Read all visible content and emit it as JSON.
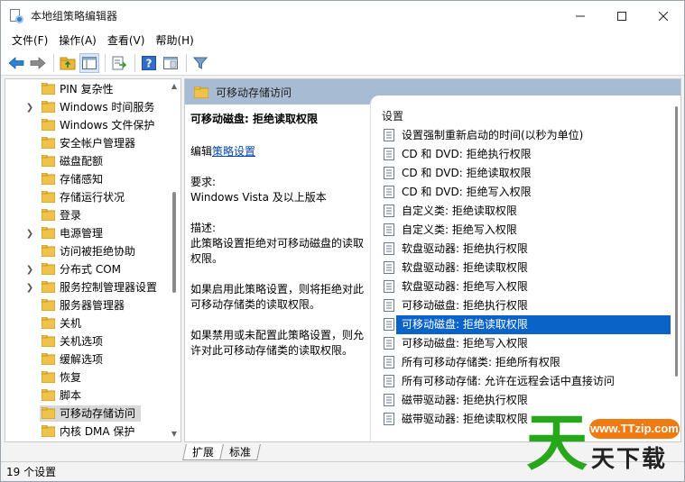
{
  "window": {
    "title": "本地组策略编辑器",
    "controls": [
      "minimize",
      "maximize",
      "close"
    ]
  },
  "menu": [
    {
      "label": "文件(F)"
    },
    {
      "label": "操作(A)"
    },
    {
      "label": "查看(V)"
    },
    {
      "label": "帮助(H)"
    }
  ],
  "toolbar": {
    "icons": [
      "back-arrow-icon",
      "forward-arrow-icon",
      "up-folder-icon",
      "show-hide-tree-icon",
      "export-list-icon",
      "help-icon",
      "properties-icon",
      "filter-icon"
    ]
  },
  "tree": {
    "items": [
      {
        "label": "PIN 复杂性",
        "expandable": false
      },
      {
        "label": "Windows 时间服务",
        "expandable": true
      },
      {
        "label": "Windows 文件保护",
        "expandable": false
      },
      {
        "label": "安全帐户管理器",
        "expandable": false
      },
      {
        "label": "磁盘配额",
        "expandable": false
      },
      {
        "label": "存储感知",
        "expandable": false
      },
      {
        "label": "存储运行状况",
        "expandable": false
      },
      {
        "label": "登录",
        "expandable": false
      },
      {
        "label": "电源管理",
        "expandable": true
      },
      {
        "label": "访问被拒绝协助",
        "expandable": false
      },
      {
        "label": "分布式 COM",
        "expandable": true
      },
      {
        "label": "服务控制管理器设置",
        "expandable": true
      },
      {
        "label": "服务器管理器",
        "expandable": false
      },
      {
        "label": "关机",
        "expandable": false
      },
      {
        "label": "关机选项",
        "expandable": false
      },
      {
        "label": "缓解选项",
        "expandable": false
      },
      {
        "label": "恢复",
        "expandable": false
      },
      {
        "label": "脚本",
        "expandable": false
      },
      {
        "label": "可移动存储访问",
        "expandable": false,
        "selected": true
      },
      {
        "label": "内核 DMA 保护",
        "expandable": false
      }
    ]
  },
  "right": {
    "header": "可移动存储访问",
    "desc": {
      "title": "可移动磁盘: 拒绝读取权限",
      "edit_prefix": "编辑",
      "edit_link": "策略设置",
      "req_label": "要求:",
      "req_value": "Windows Vista 及以上版本",
      "desc_label": "描述:",
      "desc_1": "此策略设置拒绝对可移动磁盘的读取权限。",
      "desc_2": "如果启用此策略设置，则将拒绝对此可移动存储类的读取权限。",
      "desc_3": "如果禁用或未配置此策略设置，则允许对此可移动存储类的读取权限。"
    },
    "list_header": "设置",
    "settings": [
      {
        "label": "设置强制重新启动的时间(以秒为单位)"
      },
      {
        "label": "CD 和 DVD: 拒绝执行权限"
      },
      {
        "label": "CD 和 DVD: 拒绝读取权限"
      },
      {
        "label": "CD 和 DVD: 拒绝写入权限"
      },
      {
        "label": "自定义类: 拒绝读取权限"
      },
      {
        "label": "自定义类: 拒绝写入权限"
      },
      {
        "label": "软盘驱动器: 拒绝执行权限"
      },
      {
        "label": "软盘驱动器: 拒绝读取权限"
      },
      {
        "label": "软盘驱动器: 拒绝写入权限"
      },
      {
        "label": "可移动磁盘: 拒绝执行权限"
      },
      {
        "label": "可移动磁盘: 拒绝读取权限",
        "selected": true
      },
      {
        "label": "可移动磁盘: 拒绝写入权限"
      },
      {
        "label": "所有可移动存储类: 拒绝所有权限"
      },
      {
        "label": "所有可移动存储: 允许在远程会话中直接访问"
      },
      {
        "label": "磁带驱动器: 拒绝执行权限"
      },
      {
        "label": "磁带驱动器: 拒绝读取权限"
      }
    ]
  },
  "tabs": [
    {
      "label": "扩展",
      "active": true
    },
    {
      "label": "标准",
      "active": false
    }
  ],
  "status": "19 个设置",
  "watermark": {
    "big": "天",
    "url": "www.TTzip.com",
    "small": "天下载"
  },
  "colors": {
    "selection": "#0a64c8",
    "header": "#a7bcd2",
    "link": "#0645ad",
    "watermark_green": "#27a81a",
    "watermark_orange": "#f07a12"
  }
}
